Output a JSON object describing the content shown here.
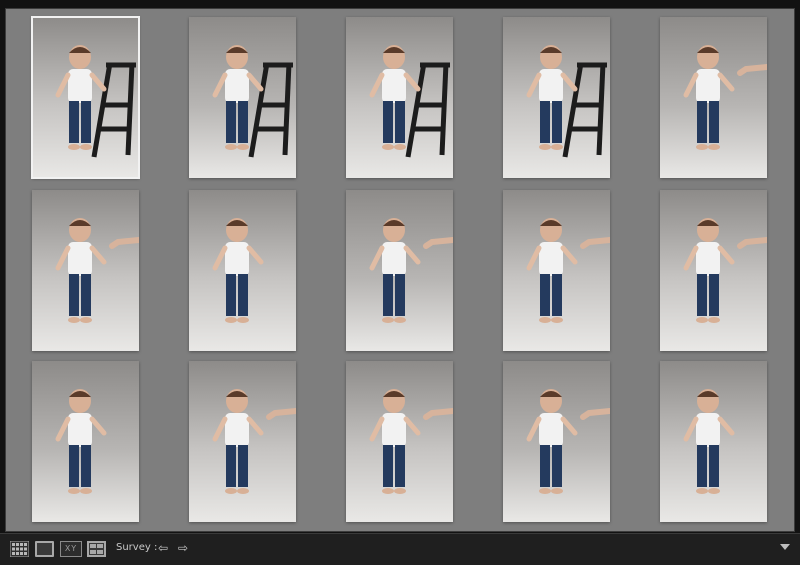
{
  "toolbar": {
    "survey_label": "Survey :",
    "compare_icon_text": "XY"
  },
  "photos": [
    {
      "id": 1,
      "selected": true,
      "chair": true,
      "hand": false
    },
    {
      "id": 2,
      "selected": false,
      "chair": true,
      "hand": false
    },
    {
      "id": 3,
      "selected": false,
      "chair": true,
      "hand": false
    },
    {
      "id": 4,
      "selected": false,
      "chair": true,
      "hand": false
    },
    {
      "id": 5,
      "selected": false,
      "chair": false,
      "hand": true
    },
    {
      "id": 6,
      "selected": false,
      "chair": false,
      "hand": true
    },
    {
      "id": 7,
      "selected": false,
      "chair": false,
      "hand": false
    },
    {
      "id": 8,
      "selected": false,
      "chair": false,
      "hand": true
    },
    {
      "id": 9,
      "selected": false,
      "chair": false,
      "hand": true
    },
    {
      "id": 10,
      "selected": false,
      "chair": false,
      "hand": true
    },
    {
      "id": 11,
      "selected": false,
      "chair": false,
      "hand": false
    },
    {
      "id": 12,
      "selected": false,
      "chair": false,
      "hand": true
    },
    {
      "id": 13,
      "selected": false,
      "chair": false,
      "hand": true
    },
    {
      "id": 14,
      "selected": false,
      "chair": false,
      "hand": true
    },
    {
      "id": 15,
      "selected": false,
      "chair": false,
      "hand": false
    }
  ],
  "colors": {
    "background_panel": "#7e7e7e",
    "selection_border": "#f2f2f2",
    "toolbar_bg": "#1f1f1f"
  }
}
